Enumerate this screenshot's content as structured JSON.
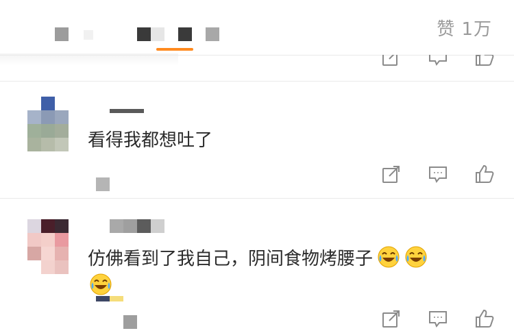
{
  "header": {
    "likes_label": "赞 1万"
  },
  "comments": [
    {
      "text": "看得我都想吐了",
      "emoji_count": 0
    },
    {
      "text": "仿佛看到了我自己，阴间食物烤腰子",
      "emoji_inline": [
        "laugh-cry-icon",
        "laugh-cry-icon"
      ],
      "emoji_second_line": [
        "laugh-cry-icon"
      ]
    }
  ],
  "actions": [
    "share-icon",
    "comment-icon",
    "like-icon"
  ],
  "colors": {
    "accent": "#ff8a1f",
    "divider": "#e9e9e9",
    "icon": "#8a8a8a",
    "text": "#2b2b2b",
    "muted": "#9a9a9a"
  }
}
